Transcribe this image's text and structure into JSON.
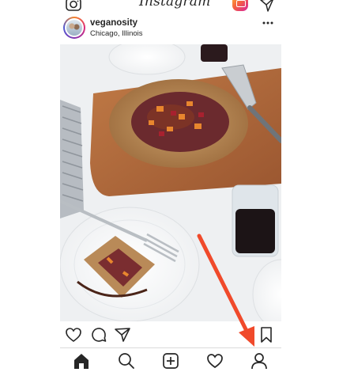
{
  "app": {
    "brand": "Instagram"
  },
  "post": {
    "username": "veganosity",
    "location": "Chicago, Illinois"
  },
  "icons": {
    "topbar": [
      "camera-icon",
      "igtv-icon",
      "paper-plane-icon"
    ],
    "post_header": [
      "more-options-icon"
    ],
    "actions": [
      "heart-icon",
      "comment-icon",
      "share-icon",
      "bookmark-icon"
    ],
    "tabbar": [
      "home-icon",
      "search-icon",
      "add-post-icon",
      "activity-heart-icon",
      "profile-icon"
    ]
  },
  "colors": {
    "text": "#262626",
    "divider": "#dbdbdb",
    "annotation_arrow": "#f04a2b"
  }
}
